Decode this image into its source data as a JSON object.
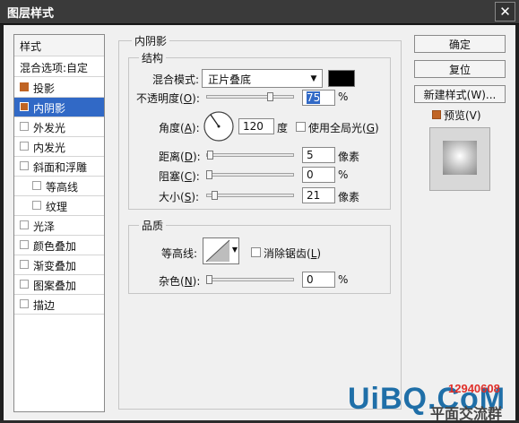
{
  "dialog": {
    "title": "图层样式",
    "close_glyph": "✕"
  },
  "left_panel": {
    "header": "样式",
    "blend_options": "混合选项:自定",
    "items": [
      {
        "label": "投影",
        "checked": true,
        "selected": false
      },
      {
        "label": "内阴影",
        "checked": true,
        "selected": true
      },
      {
        "label": "外发光",
        "checked": false,
        "selected": false
      },
      {
        "label": "内发光",
        "checked": false,
        "selected": false
      },
      {
        "label": "斜面和浮雕",
        "checked": false,
        "selected": false
      },
      {
        "label": "等高线",
        "checked": false,
        "selected": false
      },
      {
        "label": "纹理",
        "checked": false,
        "selected": false
      },
      {
        "label": "光泽",
        "checked": false,
        "selected": false
      },
      {
        "label": "颜色叠加",
        "checked": false,
        "selected": false
      },
      {
        "label": "渐变叠加",
        "checked": false,
        "selected": false
      },
      {
        "label": "图案叠加",
        "checked": false,
        "selected": false
      },
      {
        "label": "描边",
        "checked": false,
        "selected": false
      }
    ]
  },
  "inner_shadow": {
    "section_title": "内阴影",
    "structure": {
      "title": "结构",
      "blend_mode_label": "混合模式:",
      "blend_mode_value": "正片叠底",
      "blend_color": "#000000",
      "opacity_label": "不透明度(",
      "opacity_key": "O",
      "opacity_suffix": "):",
      "opacity_value": "75",
      "opacity_unit": "%",
      "opacity_fraction": 0.75,
      "angle_label": "角度(",
      "angle_key": "A",
      "angle_suffix": "):",
      "angle_value": "120",
      "angle_unit": "度",
      "global_light_label": "使用全局光(",
      "global_light_key": "G",
      "global_light_suffix": ")",
      "distance_label": "距离(",
      "distance_key": "D",
      "distance_suffix": "):",
      "distance_value": "5",
      "distance_unit": "像素",
      "choke_label": "阻塞(",
      "choke_key": "C",
      "choke_suffix": "):",
      "choke_value": "0",
      "choke_unit": "%",
      "size_label": "大小(",
      "size_key": "S",
      "size_suffix": "):",
      "size_value": "21",
      "size_unit": "像素"
    },
    "quality": {
      "title": "品质",
      "contour_label": "等高线:",
      "antialias_label": "消除锯齿(",
      "antialias_key": "L",
      "antialias_suffix": ")",
      "noise_label": "杂色(",
      "noise_key": "N",
      "noise_suffix": "):",
      "noise_value": "0",
      "noise_unit": "%"
    }
  },
  "buttons": {
    "ok": "确定",
    "reset": "复位",
    "new_style": "新建样式(W)...",
    "preview_label": "预览(V)"
  },
  "watermark": {
    "text": "UiBQ.CoM",
    "red_text": "12940608",
    "sub_text": "平面交流群"
  }
}
